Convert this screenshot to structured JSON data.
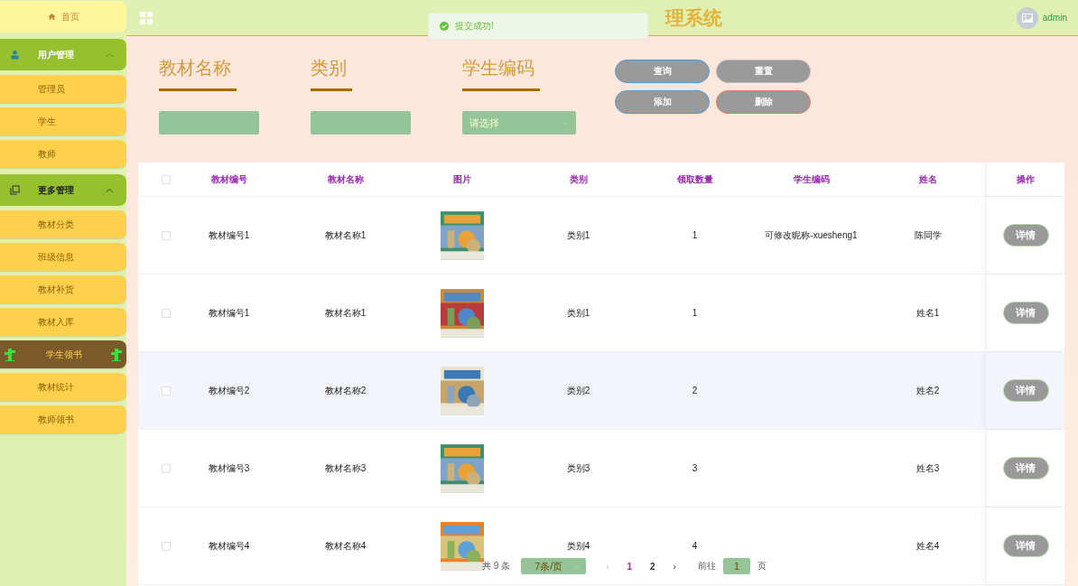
{
  "sidebar": {
    "home": {
      "label": "首页"
    },
    "groups": [
      {
        "label": "用户管理",
        "expanded": true,
        "children": [
          {
            "label": "管理员",
            "selected": false
          },
          {
            "label": "学生",
            "selected": false
          },
          {
            "label": "教师",
            "selected": false
          }
        ]
      },
      {
        "label": "更多管理",
        "expanded": true,
        "children": [
          {
            "label": "教材分类",
            "selected": false
          },
          {
            "label": "班级信息",
            "selected": false
          },
          {
            "label": "教材补货",
            "selected": false
          },
          {
            "label": "教材入库",
            "selected": false
          },
          {
            "label": "学生领书",
            "selected": true
          },
          {
            "label": "教材统计",
            "selected": false
          },
          {
            "label": "教师领书",
            "selected": false
          }
        ]
      }
    ]
  },
  "header": {
    "title": "理系统",
    "user": "admin"
  },
  "toast": {
    "message": "提交成功!"
  },
  "search": {
    "fields": [
      {
        "label": "教材名称",
        "kind": "input"
      },
      {
        "label": "类别",
        "kind": "input"
      },
      {
        "label": "学生编码",
        "kind": "select",
        "placeholder": "请选择"
      }
    ],
    "buttons": [
      {
        "label": "查询",
        "kind": "primary"
      },
      {
        "label": "重置",
        "kind": "default"
      },
      {
        "label": "添加",
        "kind": "primary"
      },
      {
        "label": "删除",
        "kind": "danger"
      }
    ]
  },
  "table": {
    "all_checked": false,
    "columns": [
      "教材编号",
      "教材名称",
      "图片",
      "类别",
      "领取数量",
      "学生编码",
      "姓名",
      "操作"
    ],
    "rows": [
      {
        "checked": false,
        "highlighted": false,
        "cells": [
          "教材编号1",
          "教材名称1",
          "",
          "类别1",
          "1",
          "可修改昵称-xuesheng1",
          "陈同学"
        ],
        "action": "详情"
      },
      {
        "checked": false,
        "highlighted": false,
        "cells": [
          "教材编号1",
          "教材名称1",
          "",
          "类别1",
          "1",
          "",
          "姓名1"
        ],
        "action": "详情"
      },
      {
        "checked": false,
        "highlighted": true,
        "cells": [
          "教材编号2",
          "教材名称2",
          "",
          "类别2",
          "2",
          "",
          "姓名2"
        ],
        "action": "详情"
      },
      {
        "checked": false,
        "highlighted": false,
        "cells": [
          "教材编号3",
          "教材名称3",
          "",
          "类别3",
          "3",
          "",
          "姓名3"
        ],
        "action": "详情"
      },
      {
        "checked": false,
        "highlighted": false,
        "cells": [
          "教材编号4",
          "教材名称4",
          "",
          "类别4",
          "4",
          "",
          "姓名4"
        ],
        "action": "详情"
      }
    ]
  },
  "pagination": {
    "total": "共 9 条",
    "page_size": "7条/页",
    "prev": "‹",
    "pages": [
      {
        "label": "1",
        "selected": true
      },
      {
        "label": "2",
        "selected": false
      }
    ],
    "next": "›",
    "goto": "前往",
    "goto_value": "1",
    "page_unit": "页"
  }
}
